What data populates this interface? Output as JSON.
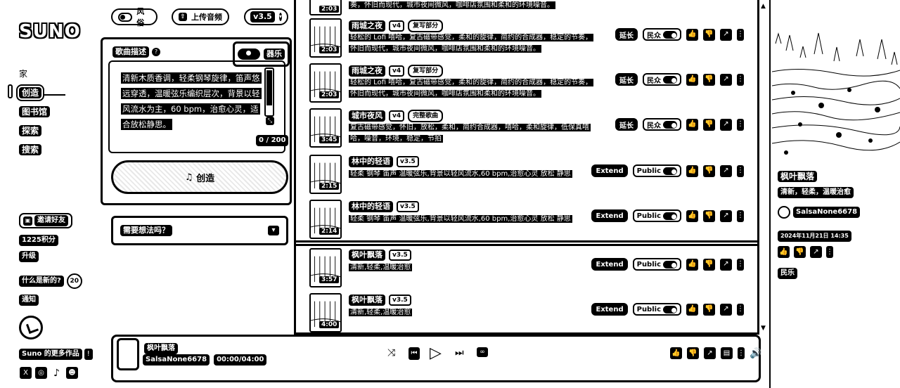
{
  "app": {
    "logo": "SUNO"
  },
  "nav": {
    "home": "家",
    "create": "创造",
    "library": "图书馆",
    "explore": "探索",
    "search": "搜索"
  },
  "sidebar": {
    "invite": "邀请好友",
    "credits": "1225积分",
    "upgrade": "升级",
    "whats_new": "什么是新的?",
    "whats_new_count": "20",
    "notifications": "通知",
    "more_works": "Suno 的更多作品",
    "socials": [
      "x-icon",
      "instagram-icon",
      "tiktok-icon",
      "discord-icon"
    ]
  },
  "create": {
    "style_toggle": "风俗",
    "upload_audio": "上传音频",
    "version": "v3.5",
    "desc_label": "歌曲描述",
    "instrumental": "器乐",
    "prompt": "清新木质香调，轻柔钢琴旋律，笛声悠远穿透，温暖弦乐编织层次，背景以轻风流水为主，60 bpm，治愈心灵，适合放松静思。",
    "char_count": "0 / 200",
    "create_button": "创造",
    "idea_prompt": "需要想法吗？"
  },
  "songs": [
    {
      "title": "雨城之夜",
      "version": "v4",
      "badge": "复写部分",
      "desc": "轻松的 Lofi 嘻哈，复古磁带感觉，柔和的旋律，简约的合成器，稳定的节奏，怀旧而现代，城市夜间微风，咖啡店氛围和柔和的环境噪音。",
      "duration": "2:03",
      "extend": "延长",
      "visibility": "民众"
    },
    {
      "title": "雨城之夜",
      "version": "v4",
      "badge": "复写部分",
      "desc": "轻松的 Lofi 嘻哈，复古磁带感觉，柔和的旋律，简约的合成器，稳定的节奏，怀旧而现代，城市夜间微风，咖啡店氛围和柔和的环境噪音。",
      "duration": "2:03",
      "extend": "延长",
      "visibility": "民众"
    },
    {
      "title": "城市夜风",
      "version": "v4",
      "badge": "完整歌曲",
      "desc": "复古磁带感觉，怀旧，放松，柔和，简约合成器，嘻哈，柔和旋律，低保真嘻哈，噪音，环境，稳定，节拍",
      "duration": "3:45",
      "extend": "延长",
      "visibility": "民众"
    },
    {
      "title": "林中的轻语",
      "version": "v3.5",
      "badge": "",
      "desc": "轻柔 钢琴 笛声 温暖弦乐,背景以轻风流水,60 bpm,治愈心灵 放松 静思",
      "duration": "2:15",
      "extend": "Extend",
      "visibility": "Public"
    },
    {
      "title": "林中的轻语",
      "version": "v3.5",
      "badge": "",
      "desc": "轻柔 钢琴 笛声 温暖弦乐,背景以轻风流水,60 bpm,治愈心灵 放松 静思",
      "duration": "2:14",
      "extend": "Extend",
      "visibility": "Public"
    },
    {
      "title": "枫叶飘落",
      "version": "v3.5",
      "badge": "",
      "desc": "清新,轻柔,温暖治愈",
      "duration": "3:57",
      "extend": "Extend",
      "visibility": "Public"
    },
    {
      "title": "枫叶飘落",
      "version": "v3.5",
      "badge": "",
      "desc": "清新,轻柔,温暖治愈",
      "duration": "4:00",
      "extend": "Extend",
      "visibility": "Public"
    }
  ],
  "top_partial_desc": "奏，怀旧而现代，城市夜间微风，咖啡店氛围和柔和的环境噪音。",
  "top_partial_duration": "2:03",
  "detail": {
    "title": "枫叶飘落",
    "tags": "清新，轻柔，温暖治愈",
    "user": "SalsaNone6678",
    "date": "2024年11月21日 14:35",
    "genre": "民乐"
  },
  "player": {
    "title": "枫叶飘落",
    "artist": "SalsaNone6678",
    "time": "00:00/04:00"
  }
}
